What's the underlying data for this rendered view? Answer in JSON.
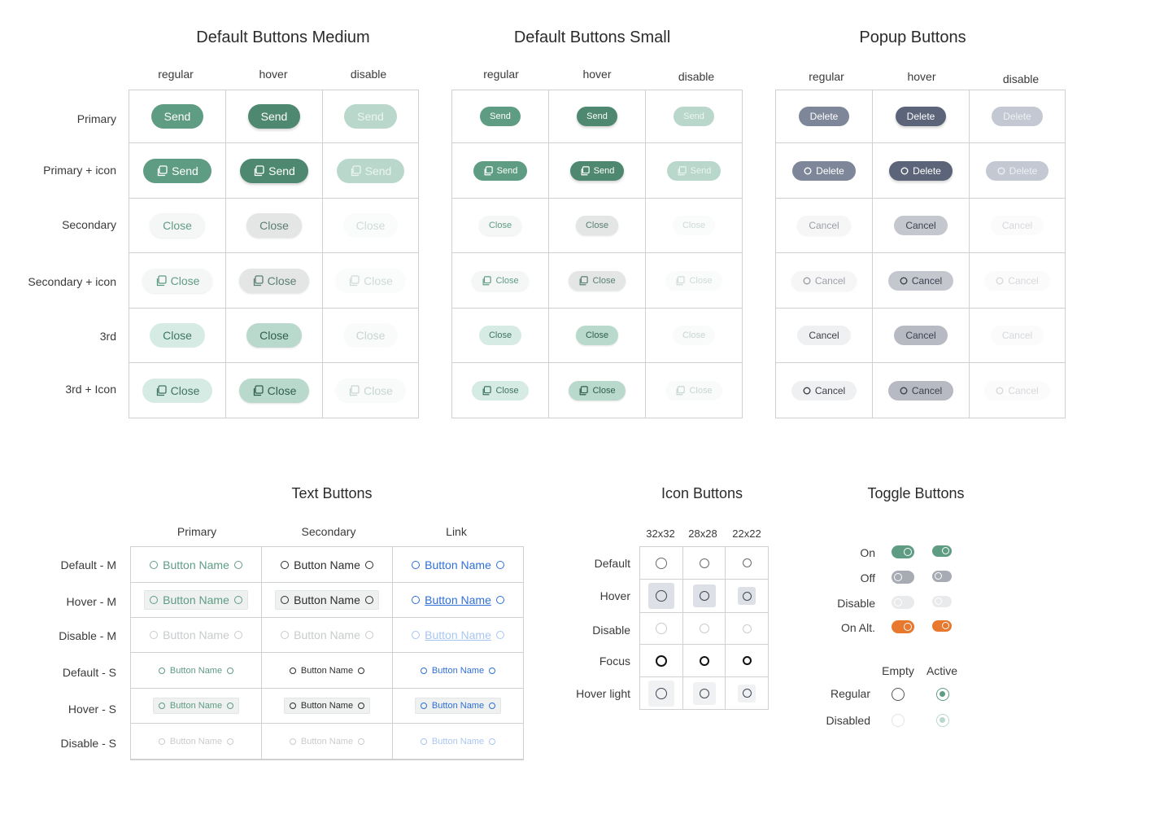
{
  "section_titles": {
    "medium": "Default Buttons Medium",
    "small": "Default Buttons Small",
    "popup": "Popup Buttons",
    "text": "Text Buttons",
    "icon": "Icon Buttons",
    "toggle": "Toggle Buttons"
  },
  "states": [
    "regular",
    "hover",
    "disable"
  ],
  "row_labels": [
    "Primary",
    "Primary + icon",
    "Secondary",
    "Secondary + icon",
    "3rd",
    "3rd + Icon"
  ],
  "labels": {
    "send": "Send",
    "close": "Close",
    "delete": "Delete",
    "cancel": "Cancel"
  },
  "text_buttons": {
    "columns": [
      "Primary",
      "Secondary",
      "Link"
    ],
    "rows": [
      "Default - M",
      "Hover - M",
      "Disable - M",
      "Default - S",
      "Hover - S",
      "Disable - S"
    ],
    "label": "Button Name"
  },
  "icon_buttons": {
    "columns": [
      "32x32",
      "28x28",
      "22x22"
    ],
    "rows": [
      "Default",
      "Hover",
      "Disable",
      "Focus",
      "Hover light"
    ]
  },
  "toggle_buttons": {
    "rows": [
      "On",
      "Off",
      "Disable",
      "On Alt."
    ],
    "radio_columns": [
      "Empty",
      "Active"
    ],
    "radio_rows": [
      "Regular",
      "Disabled"
    ]
  },
  "colors": {
    "primary": "#5f9c84",
    "popup": "#7d8799",
    "link": "#2f6fd6",
    "orange": "#e8782e"
  }
}
